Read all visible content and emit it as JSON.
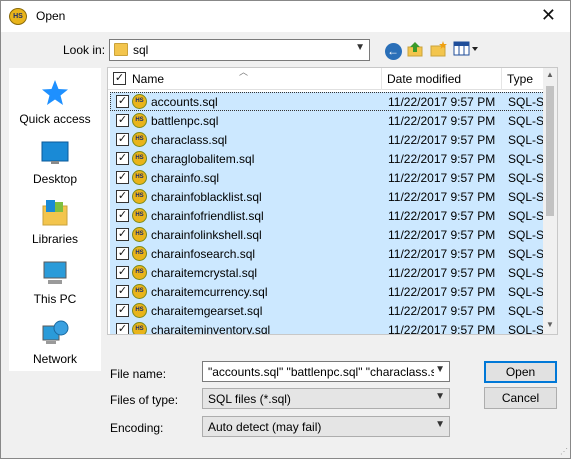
{
  "window": {
    "title": "Open",
    "app_badge": "HS",
    "close_glyph": "✕"
  },
  "lookin": {
    "label": "Look in:",
    "value": "sql"
  },
  "places": [
    {
      "label": "Quick access",
      "icon": "star-icon"
    },
    {
      "label": "Desktop",
      "icon": "desktop-icon"
    },
    {
      "label": "Libraries",
      "icon": "libraries-icon"
    },
    {
      "label": "This PC",
      "icon": "computer-icon"
    },
    {
      "label": "Network",
      "icon": "network-icon"
    }
  ],
  "columns": {
    "name": "Name",
    "date": "Date modified",
    "type": "Type"
  },
  "files": [
    {
      "name": "accounts.sql",
      "date": "11/22/2017 9:57 PM",
      "type": "SQL-Sc"
    },
    {
      "name": "battlenpc.sql",
      "date": "11/22/2017 9:57 PM",
      "type": "SQL-Sc"
    },
    {
      "name": "characlass.sql",
      "date": "11/22/2017 9:57 PM",
      "type": "SQL-Sc"
    },
    {
      "name": "charaglobalitem.sql",
      "date": "11/22/2017 9:57 PM",
      "type": "SQL-Sc"
    },
    {
      "name": "charainfo.sql",
      "date": "11/22/2017 9:57 PM",
      "type": "SQL-Sc"
    },
    {
      "name": "charainfoblacklist.sql",
      "date": "11/22/2017 9:57 PM",
      "type": "SQL-Sc"
    },
    {
      "name": "charainfofriendlist.sql",
      "date": "11/22/2017 9:57 PM",
      "type": "SQL-Sc"
    },
    {
      "name": "charainfolinkshell.sql",
      "date": "11/22/2017 9:57 PM",
      "type": "SQL-Sc"
    },
    {
      "name": "charainfosearch.sql",
      "date": "11/22/2017 9:57 PM",
      "type": "SQL-Sc"
    },
    {
      "name": "charaitemcrystal.sql",
      "date": "11/22/2017 9:57 PM",
      "type": "SQL-Sc"
    },
    {
      "name": "charaitemcurrency.sql",
      "date": "11/22/2017 9:57 PM",
      "type": "SQL-Sc"
    },
    {
      "name": "charaitemgearset.sql",
      "date": "11/22/2017 9:57 PM",
      "type": "SQL-Sc"
    },
    {
      "name": "charaiteminventory.sql",
      "date": "11/22/2017 9:57 PM",
      "type": "SQL-Sc"
    }
  ],
  "form": {
    "filename_label": "File name:",
    "filename_value": "\"accounts.sql\" \"battlenpc.sql\" \"characlass.sql\"",
    "filetype_label": "Files of type:",
    "filetype_value": "SQL files (*.sql)",
    "encoding_label": "Encoding:",
    "encoding_value": "Auto detect (may fail)"
  },
  "buttons": {
    "open": "Open",
    "cancel": "Cancel"
  },
  "colors": {
    "selection": "#cce8ff",
    "accent": "#0078d7"
  }
}
